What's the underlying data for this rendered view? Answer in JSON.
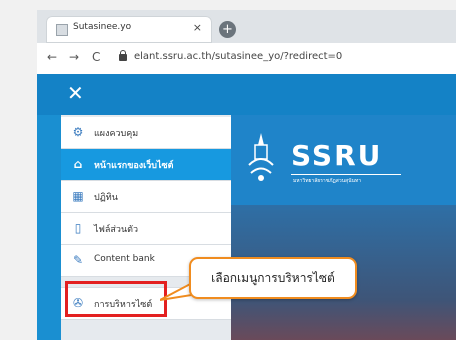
{
  "browser": {
    "tab_title": "Sutasinee.yo",
    "tab_close": "×",
    "new_tab": "+",
    "url": "elant.ssru.ac.th/sutasinee_yo/?redirect=0",
    "back": "←",
    "forward": "→",
    "reload": "C"
  },
  "site": {
    "close_glyph": "✕",
    "logo_text": "SSRU",
    "logo_sub": "มหาวิทยาลัยราชภัฏสวนสุนันทา"
  },
  "sidebar": {
    "items": [
      {
        "label": "แผงควบคุม",
        "icon": "dashboard-icon",
        "glyph": "⚙"
      },
      {
        "label": "หน้าแรกของเว็บไซต์",
        "icon": "home-icon",
        "glyph": "⌂"
      },
      {
        "label": "ปฏิทิน",
        "icon": "calendar-icon",
        "glyph": "▦"
      },
      {
        "label": "ไฟล์ส่วนตัว",
        "icon": "file-icon",
        "glyph": "▯"
      },
      {
        "label": "Content bank",
        "icon": "pencil-icon",
        "glyph": "✎"
      },
      {
        "label": "การบริหารไซต์",
        "icon": "wrench-icon",
        "glyph": "✇"
      }
    ]
  },
  "callout": {
    "text": "เลือกเมนูการบริหารไซต์"
  },
  "colors": {
    "highlight": "#e32020",
    "callout_border": "#f08c1f",
    "active": "#1799e0"
  }
}
